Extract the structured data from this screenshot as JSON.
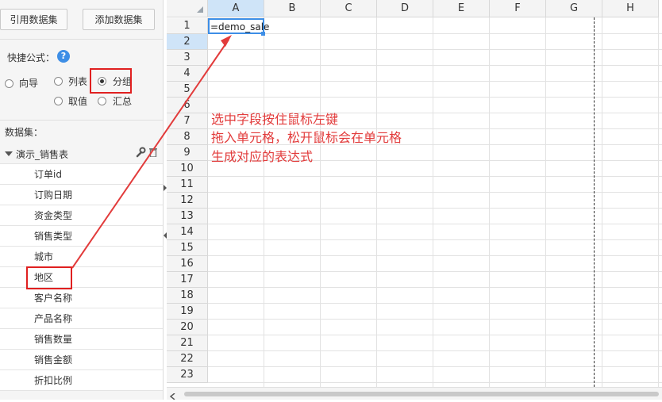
{
  "toolbar": {
    "cite_dataset": "引用数据集",
    "add_dataset": "添加数据集"
  },
  "quick_formula": {
    "label": "快捷公式：",
    "help_icon": "?",
    "options": {
      "wizard": "向导",
      "list": "列表",
      "group": "分组",
      "value": "取值",
      "summary": "汇总"
    },
    "selected": "group"
  },
  "datasets": {
    "label": "数据集：",
    "table_name": "演示_销售表",
    "fields": [
      "订单id",
      "订购日期",
      "资金类型",
      "销售类型",
      "城市",
      "地区",
      "客户名称",
      "产品名称",
      "销售数量",
      "销售金额",
      "折扣比例"
    ]
  },
  "sheet": {
    "columns": [
      "A",
      "B",
      "C",
      "D",
      "E",
      "F",
      "G",
      "H"
    ],
    "rows": [
      "1",
      "2",
      "3",
      "4",
      "5",
      "6",
      "7",
      "8",
      "9",
      "10",
      "11",
      "12",
      "13",
      "14",
      "15",
      "16",
      "17",
      "18",
      "19",
      "20",
      "21",
      "22",
      "23"
    ],
    "selected_column": "A",
    "selected_row": "2",
    "cell_A1": "=demo_sale"
  },
  "annotation": {
    "lines": [
      "选中字段按住鼠标左键",
      "拖入单元格，松开鼠标会在单元格",
      "生成对应的表达式"
    ],
    "color": "#e23b3b"
  },
  "icons": {
    "tree_toggle": "triangle-down-icon",
    "edit": "wrench-icon",
    "delete": "trash-icon"
  }
}
